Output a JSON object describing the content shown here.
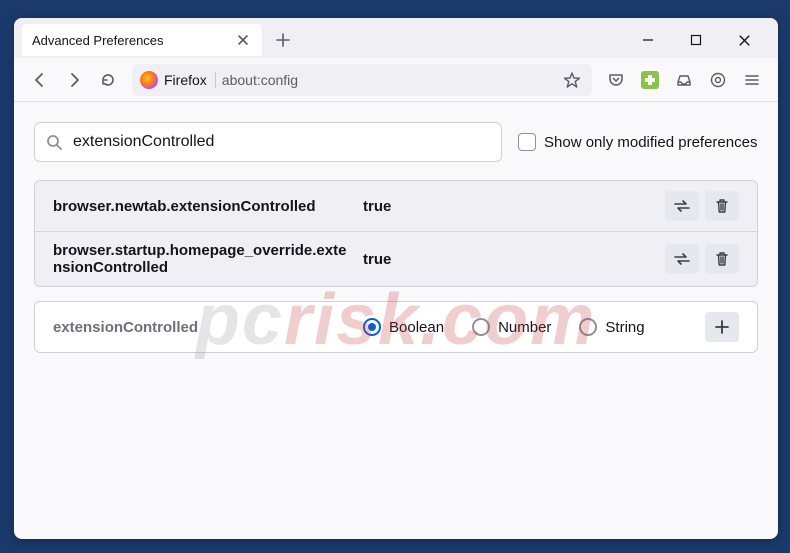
{
  "tab": {
    "title": "Advanced Preferences"
  },
  "urlbar": {
    "identity": "Firefox",
    "url": "about:config"
  },
  "search": {
    "value": "extensionControlled",
    "checkbox_label": "Show only modified preferences"
  },
  "results": [
    {
      "name": "browser.newtab.extensionControlled",
      "value": "true"
    },
    {
      "name": "browser.startup.homepage_override.extensionControlled",
      "value": "true"
    }
  ],
  "newpref": {
    "name": "extensionControlled",
    "types": [
      {
        "label": "Boolean",
        "checked": true
      },
      {
        "label": "Number",
        "checked": false
      },
      {
        "label": "String",
        "checked": false
      }
    ]
  },
  "watermark": {
    "prefix": "pc",
    "suffix": "risk.com"
  }
}
